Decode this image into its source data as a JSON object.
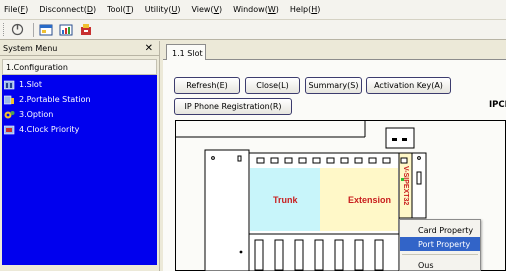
{
  "menu": [
    {
      "label": "File(",
      "key": "F",
      "tail": ")"
    },
    {
      "label": "Disconnect(",
      "key": "D",
      "tail": ")"
    },
    {
      "label": "Tool(",
      "key": "T",
      "tail": ")"
    },
    {
      "label": "Utility(",
      "key": "U",
      "tail": ")"
    },
    {
      "label": "View(",
      "key": "V",
      "tail": ")"
    },
    {
      "label": "Window(",
      "key": "W",
      "tail": ")"
    },
    {
      "label": "Help(",
      "key": "H",
      "tail": ")"
    }
  ],
  "toolbar": {
    "icons": [
      "connect-icon",
      "layout-icon",
      "stats-icon",
      "tools-icon"
    ]
  },
  "left_panel": {
    "title": "System Menu",
    "close": "✕",
    "group": "1.Configuration",
    "items": [
      {
        "label": "1.Slot",
        "icon": "slot-icon"
      },
      {
        "label": "2.Portable Station",
        "icon": "portable-station-icon"
      },
      {
        "label": "3.Option",
        "icon": "option-icon"
      },
      {
        "label": "4.Clock Priority",
        "icon": "clock-priority-icon"
      }
    ]
  },
  "tab": {
    "label": "1.1 Slot"
  },
  "buttons": {
    "refresh": "Refresh(E)",
    "close": "Close(L)",
    "summary": "Summary(S)",
    "activation": "Activation Key(A)",
    "ip_phone": "IP Phone Registration(R)"
  },
  "cabinet_title": "IPCMPR V",
  "cabinet": {
    "trunk_label": "Trunk",
    "extension_label": "Extension",
    "card_label": "V-SIPEXT32",
    "trunk_color": "#c8f5fa",
    "extension_color": "#fff8c8",
    "card_label_color": "#c81e1e"
  },
  "context_menu": {
    "items": [
      "Card Property",
      "Port Property",
      "Ous"
    ],
    "selected": "Port Property"
  }
}
